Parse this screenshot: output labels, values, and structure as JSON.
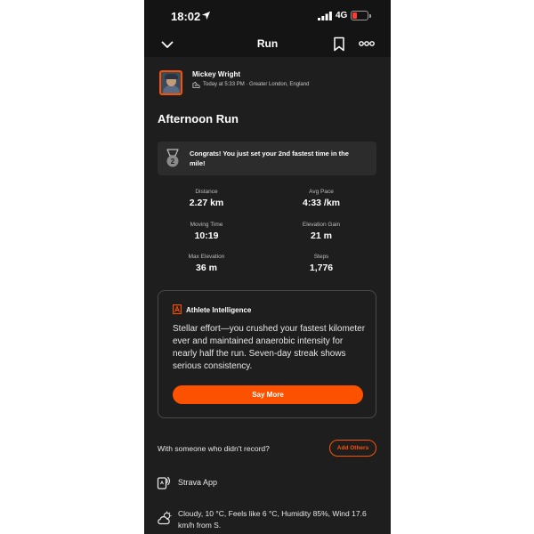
{
  "status_bar": {
    "time": "18:02",
    "network": "4G"
  },
  "nav": {
    "title": "Run"
  },
  "athlete": {
    "name": "Mickey Wright",
    "meta": "Today at 5:33 PM · Greater London, England"
  },
  "activity": {
    "title": "Afternoon Run"
  },
  "achievement": {
    "text": "Congrats! You just set your 2nd fastest time in the mile!"
  },
  "stats": [
    {
      "label": "Distance",
      "value": "2.27 km"
    },
    {
      "label": "Avg Pace",
      "value": "4:33 /km"
    },
    {
      "label": "Moving Time",
      "value": "10:19"
    },
    {
      "label": "Elevation Gain",
      "value": "21 m"
    },
    {
      "label": "Max Elevation",
      "value": "36 m"
    },
    {
      "label": "Steps",
      "value": "1,776"
    }
  ],
  "athlete_intelligence": {
    "title": "Athlete Intelligence",
    "text": "Stellar effort—you crushed your fastest kilometer ever and maintained anaerobic intensity for nearly half the run. Seven-day streak shows serious consistency.",
    "button": "Say More"
  },
  "with_others": {
    "text": "With someone who didn't record?",
    "button": "Add Others"
  },
  "device": {
    "text": "Strava App"
  },
  "weather": {
    "text": "Cloudy, 10 °C, Feels like 6 °C, Humidity 85%, Wind 17.6 km/h from S."
  },
  "colors": {
    "accent": "#fc5200",
    "background": "#1e1e1e",
    "card": "#2c2c2c",
    "battery_low": "#ff3b30"
  },
  "icons": [
    "location-arrow-icon",
    "signal-icon",
    "battery-icon",
    "chevron-down-icon",
    "bookmark-icon",
    "more-icon",
    "shoe-icon",
    "medal-icon",
    "athlete-intelligence-icon",
    "device-icon",
    "weather-icon"
  ]
}
